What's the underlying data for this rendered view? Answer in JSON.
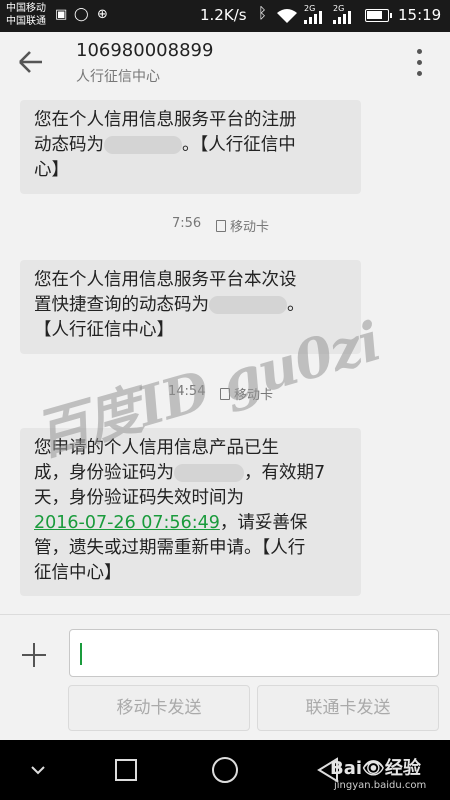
{
  "status_bar": {
    "carrier_1": "中国移动",
    "carrier_2": "中国联通",
    "net_speed": "1.2K/s",
    "signal_1_label": "2G",
    "signal_2_label": "2G",
    "time": "15:19",
    "battery_level": 0.8
  },
  "header": {
    "phone_number": "106980008899",
    "sender_name": "人行征信中心"
  },
  "messages": [
    {
      "line1": "您在个人信用信息服务平台的注册",
      "line2_pre": "动态码为",
      "line2_post": "。【人行征信中",
      "line3": "心】",
      "time": "7:56",
      "sim": "移动卡"
    },
    {
      "line1": "您在个人信用信息服务平台本次设",
      "line2_pre": "置快捷查询的动态码为",
      "line2_post": "。",
      "line3": "【人行征信中心】",
      "time": "14:54",
      "sim": "移动卡"
    },
    {
      "line1": "您申请的个人信用信息产品已生",
      "line2_pre": "成，身份验证码为",
      "line2_post": "，有效期7",
      "line3": "天，身份验证码失效时间为",
      "line4_link": "2016-07-26 07:56:49",
      "line4_post": "，请妥善保",
      "line5": "管，遗失或过期需重新申请。【人行",
      "line6": "征信中心】"
    }
  ],
  "watermark": "百度ID gu0zi",
  "composer": {
    "input_value": "",
    "send_mobile_label": "移动卡发送",
    "send_unicom_label": "联通卡发送"
  },
  "nav_bar": {
    "baidu_logo": "Bai👁经验",
    "baidu_url": "jingyan.baidu.com"
  }
}
